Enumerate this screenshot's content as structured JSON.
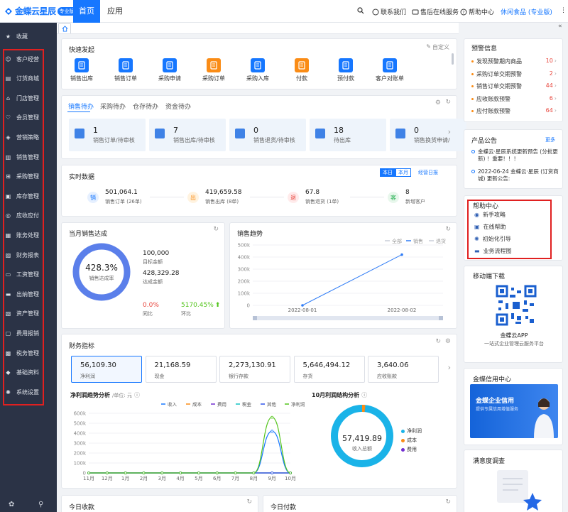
{
  "app": {
    "logo_text": "金蝶云星辰",
    "edition_badge": "专业版"
  },
  "nav": {
    "tabs": [
      "首页",
      "应用"
    ]
  },
  "topbar": {
    "contact": "联系我们",
    "service": "售后在线服务",
    "help": "帮助中心",
    "account": "休闲食品 (专业版)",
    "more": "⋮"
  },
  "sidebar": {
    "items": [
      {
        "label": "收藏",
        "icon": "star-icon"
      },
      {
        "label": "客户经营",
        "icon": "user-icon"
      },
      {
        "label": "订货商城",
        "icon": "doc-icon"
      },
      {
        "label": "门店管理",
        "icon": "store-icon"
      },
      {
        "label": "会员管理",
        "icon": "heart-icon"
      },
      {
        "label": "营销策略",
        "icon": "tag-icon"
      },
      {
        "label": "销售管理",
        "icon": "bar-icon"
      },
      {
        "label": "采购管理",
        "icon": "cart-icon"
      },
      {
        "label": "库存管理",
        "icon": "box-icon"
      },
      {
        "label": "应收应付",
        "icon": "coin-icon"
      },
      {
        "label": "账务处理",
        "icon": "book-icon"
      },
      {
        "label": "财务报表",
        "icon": "chart-icon"
      },
      {
        "label": "工资管理",
        "icon": "wallet-icon"
      },
      {
        "label": "出纳管理",
        "icon": "cash-icon"
      },
      {
        "label": "资产管理",
        "icon": "asset-icon"
      },
      {
        "label": "费用报销",
        "icon": "receipt-icon"
      },
      {
        "label": "税务管理",
        "icon": "tax-icon"
      },
      {
        "label": "基础资料",
        "icon": "layers-icon"
      },
      {
        "label": "系统设置",
        "icon": "gear-icon"
      }
    ]
  },
  "quick": {
    "title": "快速发起",
    "customize": "自定义",
    "items": [
      {
        "label": "销售出库",
        "color": "#1677ff"
      },
      {
        "label": "销售订单",
        "color": "#1677ff"
      },
      {
        "label": "采购申请",
        "color": "#1677ff"
      },
      {
        "label": "采购订单",
        "color": "#fa8c16"
      },
      {
        "label": "采购入库",
        "color": "#1677ff"
      },
      {
        "label": "付款",
        "color": "#fa8c16"
      },
      {
        "label": "预付款",
        "color": "#1677ff"
      },
      {
        "label": "客户对账单",
        "color": "#1677ff"
      }
    ]
  },
  "pending": {
    "tabs": [
      "销售待办",
      "采购待办",
      "仓存待办",
      "资金待办"
    ],
    "tiles": [
      {
        "num": "1",
        "label": "销售订单/待审核"
      },
      {
        "num": "7",
        "label": "销售出库/待审核"
      },
      {
        "num": "0",
        "label": "销售退货/待审核"
      },
      {
        "num": "18",
        "label": "待出库"
      },
      {
        "num": "0",
        "label": "销售换货申请/"
      }
    ]
  },
  "realtime": {
    "title": "实时数据",
    "btn_today": "本日",
    "btn_month": "本月",
    "daily_report": "经营日报",
    "items": [
      {
        "glyph": "销",
        "value": "501,064.1",
        "label": "销售订单 (26单)",
        "bg": "#e6f0ff",
        "fg": "#1677ff"
      },
      {
        "glyph": "出",
        "value": "419,659.58",
        "label": "销售出库 (8单)",
        "bg": "#fff3e0",
        "fg": "#fa8c16"
      },
      {
        "glyph": "退",
        "value": "67.8",
        "label": "销售退货 (1单)",
        "bg": "#ffebeb",
        "fg": "#e8453c"
      },
      {
        "glyph": "客",
        "value": "8",
        "label": "新增客户",
        "bg": "#e8f7ec",
        "fg": "#2fb35a"
      }
    ]
  },
  "monthly": {
    "title": "当月销售达成",
    "ring_value": "428.3%",
    "ring_label": "销售达成率",
    "target_value": "100,000",
    "target_label": "目标金额",
    "achieved_value": "428,329.28",
    "achieved_label": "达成金额",
    "yoy_value": "0.0%",
    "yoy_label": "同比",
    "mom_value": "5170.45%",
    "mom_label": "环比"
  },
  "trend": {
    "title": "销售趋势",
    "legend": [
      "全部",
      "销售",
      "退货"
    ],
    "chart_data": {
      "type": "line",
      "x": [
        "2022-08-01",
        "2022-08-02"
      ],
      "series": [
        {
          "name": "销售",
          "values": [
            0,
            420000
          ]
        }
      ],
      "ylim": [
        0,
        500000
      ],
      "yticks": [
        "500k",
        "400k",
        "300k",
        "200k",
        "100k",
        "0"
      ]
    }
  },
  "finance": {
    "title": "财务指标",
    "tiles": [
      {
        "value": "56,109.30",
        "label": "净利润"
      },
      {
        "value": "21,168.59",
        "label": "现金"
      },
      {
        "value": "2,273,130.91",
        "label": "银行存款"
      },
      {
        "value": "5,646,494.12",
        "label": "存货"
      },
      {
        "value": "3,640.06",
        "label": "应收账款"
      }
    ],
    "profit_title": "净利润趋势分析",
    "profit_unit": "/单位: 元",
    "structure_title": "10月利润结构分析",
    "profit_chart": {
      "type": "line",
      "x": [
        "11月",
        "12月",
        "1月",
        "2月",
        "3月",
        "4月",
        "5月",
        "6月",
        "7月",
        "8月",
        "9月",
        "10月"
      ],
      "series": [
        {
          "name": "收入",
          "color": "#1677ff",
          "values": [
            0,
            0,
            0,
            0,
            0,
            0,
            0,
            0,
            0,
            0,
            420000,
            0
          ]
        },
        {
          "name": "成本",
          "color": "#fa8c16",
          "values": [
            0,
            0,
            0,
            0,
            0,
            0,
            0,
            0,
            0,
            0,
            0,
            0
          ]
        },
        {
          "name": "费用",
          "color": "#722ed1",
          "values": [
            0,
            0,
            0,
            0,
            0,
            0,
            0,
            0,
            0,
            0,
            0,
            0
          ]
        },
        {
          "name": "税金",
          "color": "#13c2c2",
          "values": [
            0,
            0,
            0,
            0,
            0,
            0,
            0,
            0,
            0,
            0,
            0,
            0
          ]
        },
        {
          "name": "其他",
          "color": "#2f54eb",
          "values": [
            0,
            0,
            0,
            0,
            0,
            0,
            0,
            0,
            0,
            0,
            0,
            0
          ]
        },
        {
          "name": "净利润",
          "color": "#52c41a",
          "values": [
            0,
            0,
            0,
            0,
            0,
            0,
            0,
            0,
            0,
            0,
            560000,
            0
          ]
        }
      ],
      "ylim": [
        0,
        600000
      ],
      "yticks": [
        "600k",
        "500k",
        "400k",
        "300k",
        "200k",
        "100k",
        "0"
      ]
    },
    "donut_value": "57,419.89",
    "donut_label": "收入总额",
    "donut_legend": [
      {
        "name": "净利润",
        "color": "#1ab3e8"
      },
      {
        "name": "成本",
        "color": "#fa8c16"
      },
      {
        "name": "费用",
        "color": "#722ed1"
      }
    ]
  },
  "bottom": {
    "receipts_title": "今日收款",
    "payments_title": "今日付款"
  },
  "alerts": {
    "title": "预警信息",
    "items": [
      {
        "label": "发现预警期内商品",
        "count": "10"
      },
      {
        "label": "采购订单交期预警",
        "count": "2"
      },
      {
        "label": "销售订单交期预警",
        "count": "44"
      },
      {
        "label": "应收账款预警",
        "count": "6"
      },
      {
        "label": "应付账款预警",
        "count": "64"
      }
    ]
  },
  "notice": {
    "title": "产品公告",
    "more": "更多",
    "items": [
      "金蝶云·星辰系统更新预告 (分批更新) ！重要！！！",
      "2022-06-24 金蝶云·星辰 (订货商城) 更新公告:"
    ]
  },
  "help": {
    "title": "帮助中心",
    "items": [
      "新手攻略",
      "在线帮助",
      "初始化引导",
      "业务流程图"
    ]
  },
  "mobile": {
    "title": "移动端下载",
    "app_name": "金蝶云APP",
    "app_desc": "一站式企业管理云服务平台"
  },
  "credit": {
    "title": "金蝶信用中心",
    "banner_title": "金蝶企业信用",
    "banner_sub": "提供专属信用增值服务"
  },
  "survey": {
    "title": "满意度调查"
  }
}
